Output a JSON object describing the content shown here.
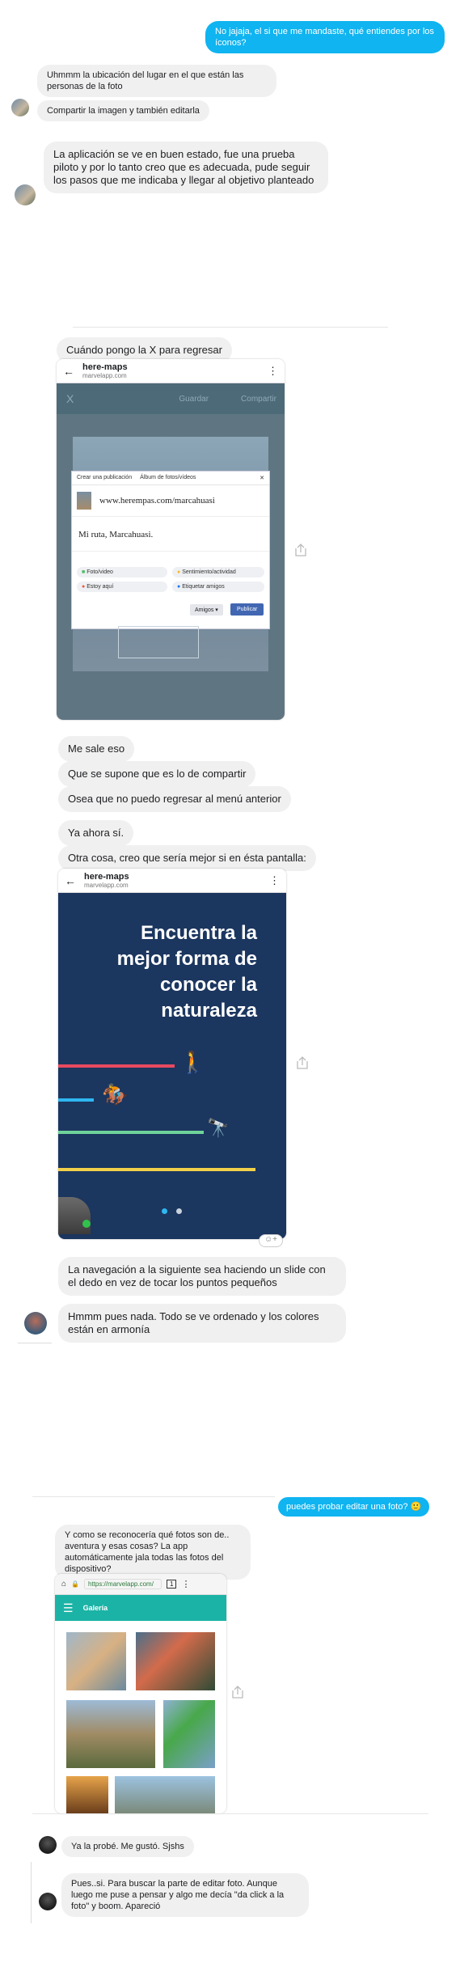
{
  "colors": {
    "accent": "#0fb4f0",
    "bubble": "#f1f0f0",
    "navy": "#1b365f",
    "teal": "#1bb3a6"
  },
  "messages": {
    "me1": "No jajaja, el si que me mandaste, qué entiendes por los íconos?",
    "o1a": "Uhmmm la ubicación del lugar en el que están las personas de la foto",
    "o1b": "Compartir la imagen y también editarla",
    "o2": "La aplicación se ve en buen estado, fue una prueba piloto y por lo tanto creo que es adecuada, pude seguir los pasos que me indicaba y llegar al objetivo planteado",
    "s1": "Cuándo pongo la X para regresar",
    "s2": "Me sale eso",
    "s3": "Que se supone que es lo de compartir",
    "s4": "Osea que no puedo regresar al menú anterior",
    "s5": "Ya ahora sí.",
    "s6": "Otra cosa, creo que sería mejor si en ésta pantalla:",
    "s7": "La navegación a la siguiente sea haciendo un slide con el dedo en vez de tocar los puntos pequeños",
    "o3": "Hmmm pues nada. Todo se ve ordenado y los colores están en armonía",
    "me2": "puedes probar editar una foto?",
    "o4": "Y como se reconocería qué fotos son de.. aventura y esas cosas? La app automáticamente jala todas las fotos del dispositivo?",
    "o5": "Ya la probé. Me gustó. Sjshs",
    "o6": "Pues..si. Para buscar la parte de editar foto. Aunque luego me puse a pensar y algo me decía \"da click a la foto\" y boom. Apareció"
  },
  "phone1": {
    "title": "here-maps",
    "url": "marvelapp.com",
    "close": "X",
    "save": "Guardar",
    "share": "Compartir",
    "fb_tab1": "Crear una publicación",
    "fb_tab2": "Álbum de fotos/vídeos",
    "fb_link": "www.herempas.com/marcahuasi",
    "fb_text": "Mi ruta, Marcahuasi.",
    "opt1": "Foto/video",
    "opt2": "Sentimiento/actividad",
    "opt3": "Estoy aquí",
    "opt4": "Etiquetar amigos",
    "audience": "Amigos ▾",
    "publish": "Publicar"
  },
  "phone2": {
    "title": "here-maps",
    "url": "marvelapp.com",
    "headline": "Encuentra la mejor forma de conocer la naturaleza"
  },
  "phone3": {
    "url": "https://marvelapp.com/",
    "section": "Galería",
    "tab_count": "1"
  }
}
